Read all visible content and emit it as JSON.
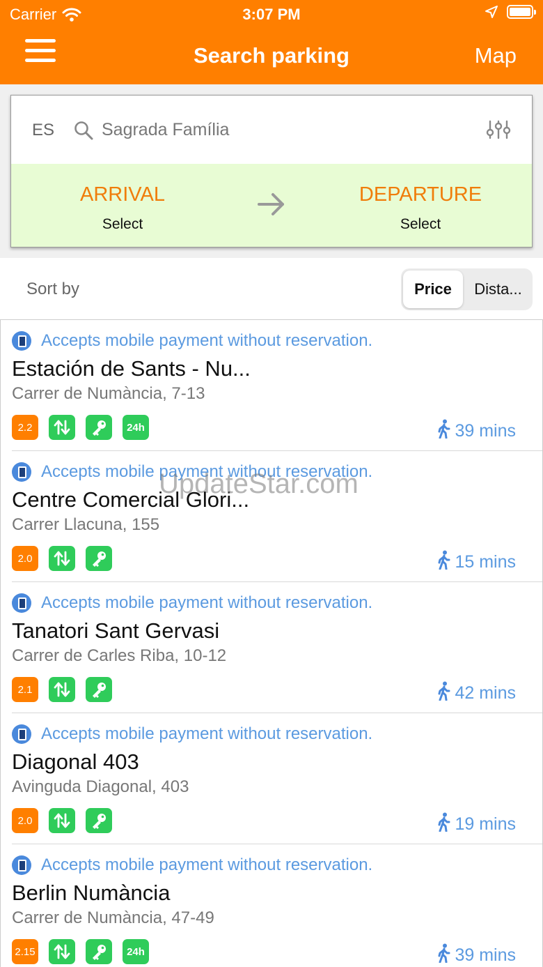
{
  "status_bar": {
    "carrier": "Carrier",
    "time": "3:07 PM"
  },
  "nav": {
    "title": "Search parking",
    "map_label": "Map"
  },
  "search": {
    "country": "ES",
    "query": "Sagrada Família"
  },
  "times": {
    "arrival_label": "ARRIVAL",
    "arrival_value": "Select",
    "departure_label": "DEPARTURE",
    "departure_value": "Select"
  },
  "sort": {
    "label": "Sort by",
    "options": [
      "Price",
      "Dista..."
    ],
    "selected": "Price"
  },
  "results": [
    {
      "payment_text": "Accepts mobile payment without reservation.",
      "title": "Estación de Sants - Nu...",
      "address": "Carrer de Numància, 7-13",
      "rating": "2.2",
      "open_24h": true,
      "label_24h": "24h",
      "walk": "39 mins"
    },
    {
      "payment_text": "Accepts mobile payment without reservation.",
      "title": "Centre Comercial Glori...",
      "address": "Carrer Llacuna, 155",
      "rating": "2.0",
      "open_24h": false,
      "walk": "15 mins"
    },
    {
      "payment_text": "Accepts mobile payment without reservation.",
      "title": "Tanatori Sant Gervasi",
      "address": "Carrer de Carles Riba, 10-12",
      "rating": "2.1",
      "open_24h": false,
      "walk": "42 mins"
    },
    {
      "payment_text": "Accepts mobile payment without reservation.",
      "title": "Diagonal 403",
      "address": "Avinguda Diagonal, 403",
      "rating": "2.0",
      "open_24h": false,
      "walk": "19 mins"
    },
    {
      "payment_text": "Accepts mobile payment without reservation.",
      "title": "Berlin Numància",
      "address": "Carrer de Numància, 47-49",
      "rating": "2.15",
      "open_24h": true,
      "label_24h": "24h",
      "walk": "39 mins"
    }
  ],
  "watermark": "UpdateStar.com",
  "colors": {
    "header": "#ff7f00",
    "times_bg": "#e8fcd4",
    "accent_orange": "#f07d0a",
    "badge_green": "#2fcc5a",
    "link_blue": "#5b9ae0"
  },
  "icons": [
    "wifi-icon",
    "location-arrow-icon",
    "battery-icon",
    "menu-icon",
    "search-icon",
    "filter-sliders-icon",
    "arrow-right-icon",
    "mobile-payment-icon",
    "elevator-icon",
    "key-icon",
    "walking-icon"
  ]
}
